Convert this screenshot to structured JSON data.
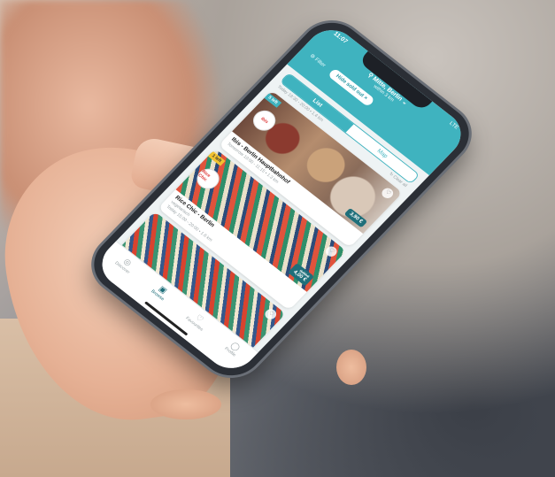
{
  "status": {
    "time": "11:07",
    "network": "LTE"
  },
  "header": {
    "location": "Mitte, Berlin",
    "radius": "within 3 km",
    "filter_label": "Filter",
    "tag_pill": "Hide sold out"
  },
  "tabs": {
    "list": "List",
    "map": "Map"
  },
  "meta": {
    "left": "Today 19:30 - 20:00 • 1.4 km",
    "right": "Clear all"
  },
  "cards": [
    {
      "badge": "5 left",
      "title": "Ibis - Berlin Hauptbahnhof",
      "subtitle": "Tomorrow 10:00 - 11:15 • 1.3 km",
      "price": "3,90 €",
      "price_old": "",
      "logo": "ibis"
    },
    {
      "badge": "1 left",
      "title": "Rice Chic - Berlin",
      "subtitle": "vegetarisch",
      "subtitle2": "Today 15:00 - 20:00 • 1.6 km",
      "price": "4,00 €",
      "price_old": "8,00 €",
      "logo": "Rice Chic"
    },
    {
      "badge": "",
      "title": "",
      "subtitle": "",
      "price": "",
      "price_old": "",
      "logo": ""
    }
  ],
  "tabbar": {
    "discover": "Discover",
    "browse": "Browse",
    "favourites": "Favourites",
    "profile": "Profile"
  },
  "colors": {
    "accent": "#3fb3bf",
    "price_bg": "#1f6f7a",
    "badge_yellow": "#f2c230"
  },
  "icons": {
    "location": "location-pin-icon",
    "filter": "filter-icon",
    "close": "close-icon",
    "refresh": "refresh-icon",
    "heart": "heart-icon",
    "discover": "compass-icon",
    "browse": "bag-icon",
    "favourites": "heart-icon",
    "profile": "person-icon"
  }
}
